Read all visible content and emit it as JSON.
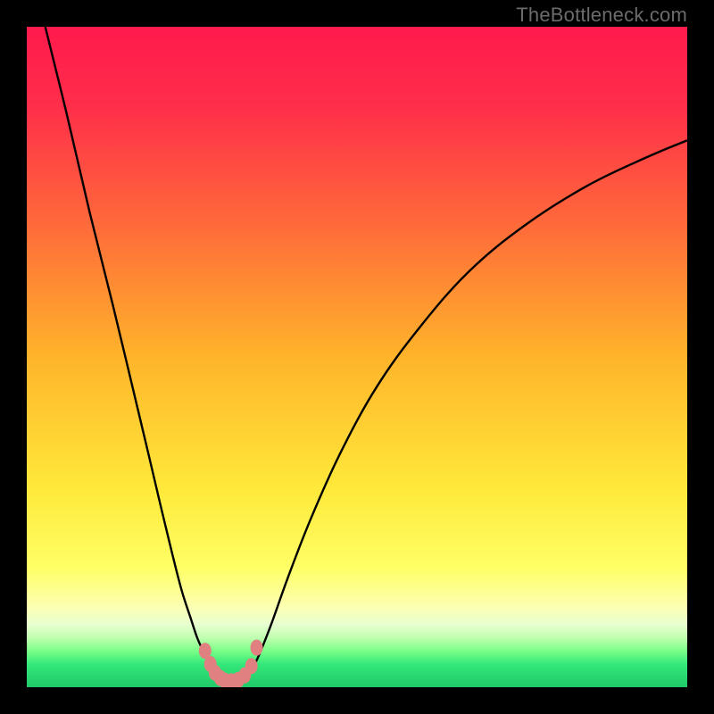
{
  "watermark": {
    "text": "TheBottleneck.com"
  },
  "colors": {
    "curve_stroke": "#000000",
    "marker_fill": "#e08080",
    "background_black": "#000000",
    "gradient_stops": [
      {
        "offset": 0.0,
        "color": "#ff1a4d"
      },
      {
        "offset": 0.12,
        "color": "#ff2e4a"
      },
      {
        "offset": 0.3,
        "color": "#ff6a3a"
      },
      {
        "offset": 0.5,
        "color": "#ffb42a"
      },
      {
        "offset": 0.7,
        "color": "#ffe93a"
      },
      {
        "offset": 0.82,
        "color": "#ffff66"
      },
      {
        "offset": 0.88,
        "color": "#fbffb4"
      },
      {
        "offset": 0.905,
        "color": "#e8ffd0"
      },
      {
        "offset": 0.925,
        "color": "#c0ffb0"
      },
      {
        "offset": 0.945,
        "color": "#7aff87"
      },
      {
        "offset": 0.965,
        "color": "#34e87a"
      },
      {
        "offset": 1.0,
        "color": "#20c868"
      }
    ]
  },
  "chart_data": {
    "type": "line",
    "title": "",
    "xlabel": "",
    "ylabel": "",
    "xlim": [
      0,
      1
    ],
    "ylim": [
      0,
      1
    ],
    "series": [
      {
        "name": "left-branch",
        "x": [
          0.028,
          0.06,
          0.095,
          0.13,
          0.16,
          0.185,
          0.205,
          0.222,
          0.235,
          0.248,
          0.258,
          0.267,
          0.275,
          0.28,
          0.285
        ],
        "y": [
          1.0,
          0.87,
          0.72,
          0.58,
          0.455,
          0.35,
          0.265,
          0.195,
          0.145,
          0.105,
          0.075,
          0.055,
          0.038,
          0.03,
          0.025
        ]
      },
      {
        "name": "valley-floor",
        "x": [
          0.285,
          0.295,
          0.305,
          0.318,
          0.328,
          0.338
        ],
        "y": [
          0.025,
          0.013,
          0.008,
          0.008,
          0.012,
          0.022
        ]
      },
      {
        "name": "right-branch",
        "x": [
          0.338,
          0.35,
          0.37,
          0.395,
          0.43,
          0.475,
          0.53,
          0.595,
          0.67,
          0.755,
          0.85,
          0.94,
          1.0
        ],
        "y": [
          0.022,
          0.045,
          0.095,
          0.165,
          0.255,
          0.355,
          0.455,
          0.545,
          0.63,
          0.7,
          0.76,
          0.803,
          0.828
        ]
      }
    ],
    "markers": {
      "name": "valley-points",
      "x": [
        0.27,
        0.278,
        0.285,
        0.293,
        0.3,
        0.31,
        0.32,
        0.33,
        0.34,
        0.348
      ],
      "y": [
        0.055,
        0.035,
        0.022,
        0.014,
        0.01,
        0.009,
        0.011,
        0.018,
        0.032,
        0.06
      ]
    }
  }
}
